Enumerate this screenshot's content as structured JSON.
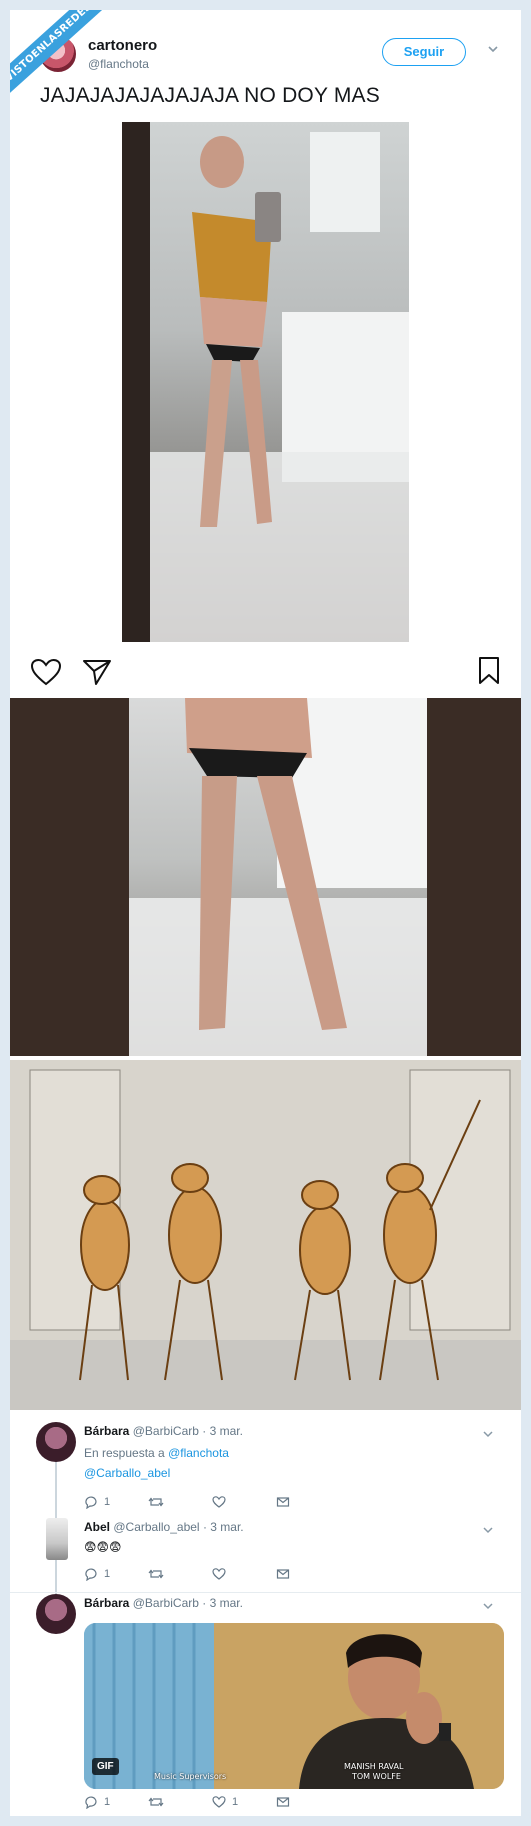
{
  "watermark": "VISTOENLASREDES",
  "tweet": {
    "author_name": "cartonero",
    "author_handle": "@flanchota",
    "follow_label": "Seguir",
    "text": "JAJAJAJAJAJAJAJA NO DOY MAS"
  },
  "colors": {
    "accent": "#1da1f2",
    "link": "#1b95e0",
    "muted": "#657786",
    "background": "#dfe9f2"
  },
  "insta": {
    "icons": [
      "heart-icon",
      "send-icon",
      "bookmark-icon"
    ]
  },
  "replies": [
    {
      "name": "Bárbara",
      "handle": "@BarbiCarb",
      "date": "· 3 mar.",
      "in_reply_prefix": "En respuesta a",
      "in_reply_handle": "@flanchota",
      "text_link": "@Carballo_abel",
      "reply_count": "1",
      "like_count": ""
    },
    {
      "name": "Abel",
      "handle": "@Carballo_abel",
      "date": "· 3 mar.",
      "text": "😨😨😨",
      "reply_count": "1",
      "like_count": ""
    },
    {
      "name": "Bárbara",
      "handle": "@BarbiCarb",
      "date": "· 3 mar.",
      "gif_badge": "GIF",
      "gif_caption_left": "Music Supervisors",
      "gif_caption_right_1": "MANISH RAVAL",
      "gif_caption_right_2": "TOM WOLFE",
      "reply_count": "1",
      "like_count": "1"
    }
  ]
}
